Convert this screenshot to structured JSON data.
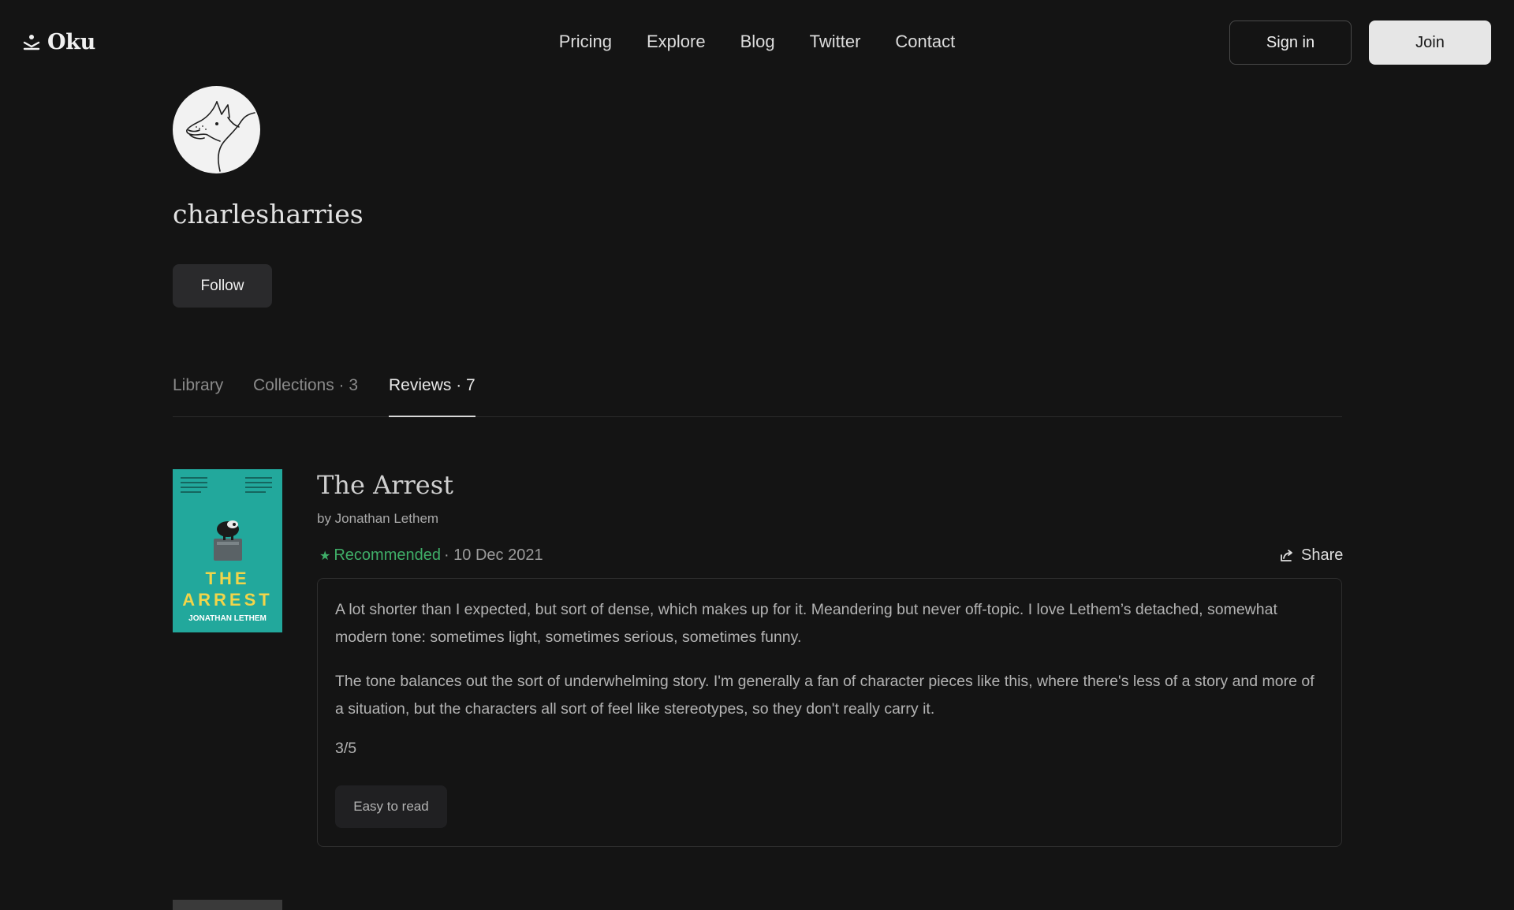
{
  "header": {
    "brand": "Oku",
    "nav": [
      "Pricing",
      "Explore",
      "Blog",
      "Twitter",
      "Contact"
    ],
    "sign_in": "Sign in",
    "join": "Join"
  },
  "profile": {
    "username": "charlesharries",
    "follow_label": "Follow"
  },
  "tabs": {
    "library": "Library",
    "collections": "Collections · 3",
    "reviews": "Reviews · 7"
  },
  "review": {
    "title": "The Arrest",
    "author": "by Jonathan Lethem",
    "recommendation": "Recommended",
    "date": "· 10 Dec 2021",
    "share": "Share",
    "paragraphs": [
      "A lot shorter than I expected, but sort of dense, which makes up for it. Meandering but never off-topic. I love Lethem’s detached, somewhat modern tone: sometimes light, sometimes serious, sometimes funny.",
      "The tone balances out the sort of underwhelming story. I'm generally a fan of character pieces like this, where there's less of a story and more of a situation, but the characters all sort of feel like stereotypes, so they don't really carry it."
    ],
    "score": "3/5",
    "tag": "Easy to read",
    "cover": {
      "title_line1": "THE",
      "title_line2": "ARREST",
      "author": "JONATHAN LETHEM",
      "bg_color": "#22a89c",
      "title_color": "#f1d54a"
    },
    "rec_color": "#3fae68"
  }
}
